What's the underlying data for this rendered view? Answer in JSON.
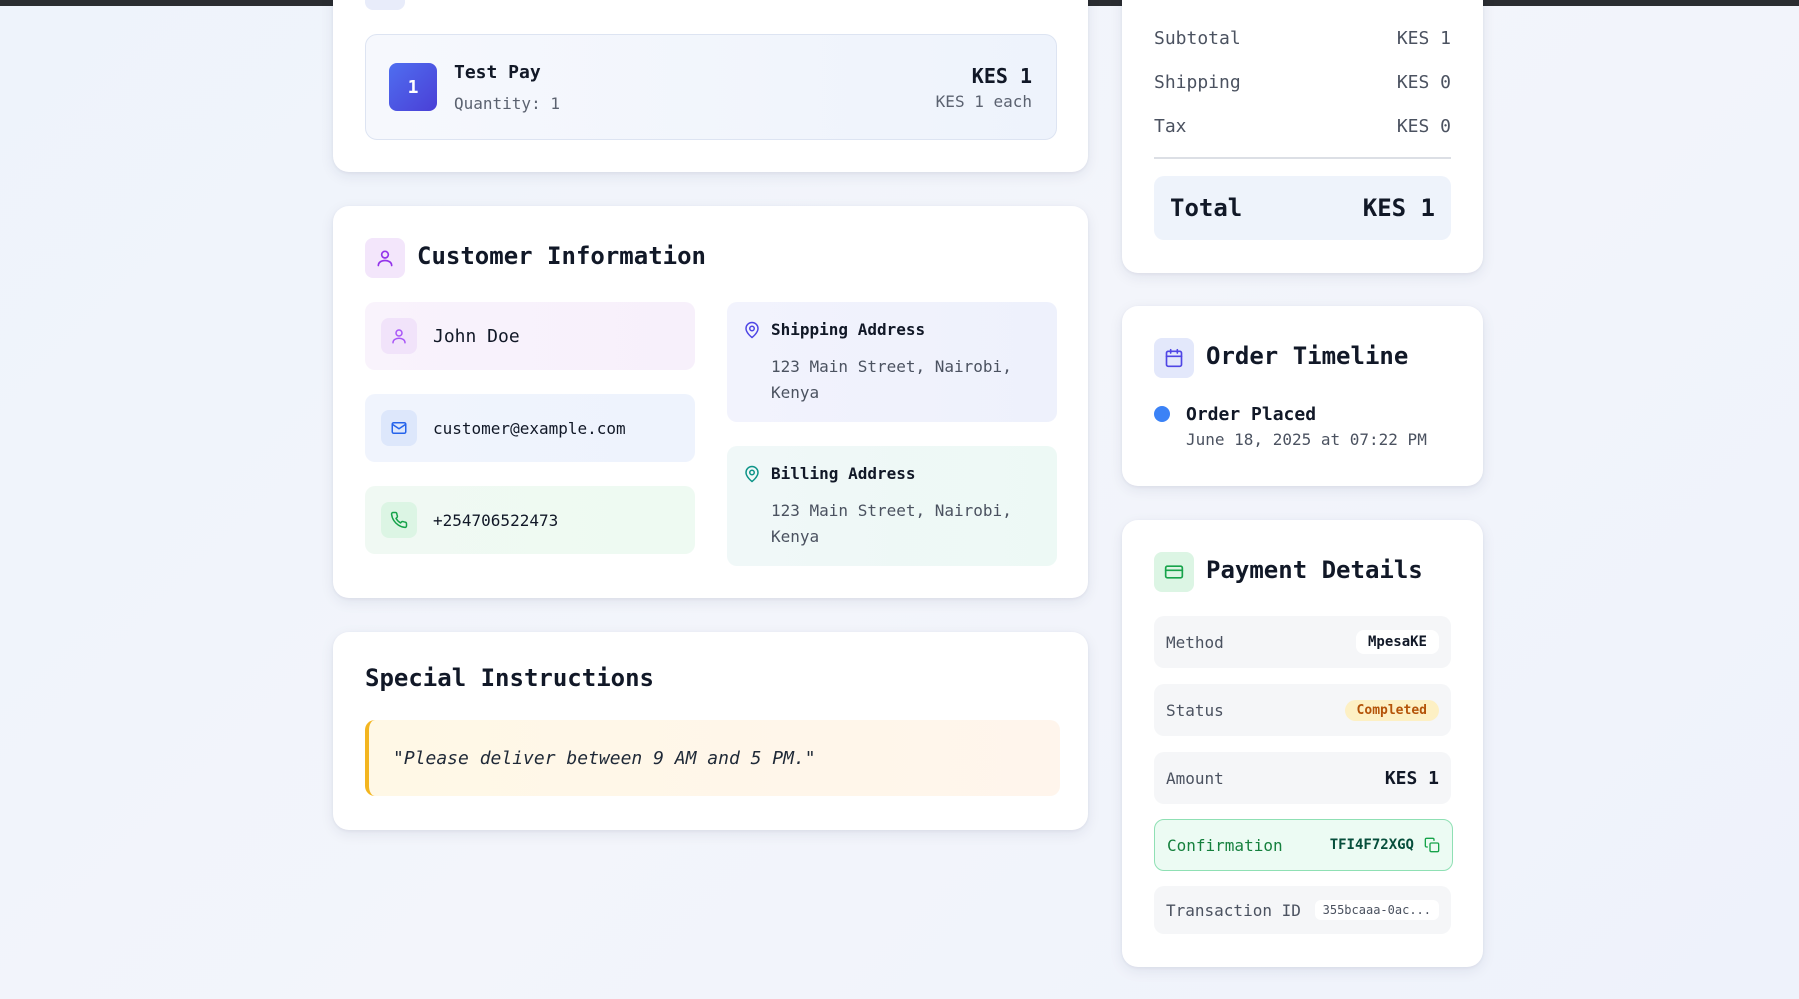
{
  "item": {
    "quantity_badge": "1",
    "name": "Test Pay",
    "quantity_label": "Quantity: 1",
    "price": "KES 1",
    "unit_price": "KES 1 each"
  },
  "customer": {
    "title": "Customer Information",
    "name": "John Doe",
    "email": "customer@example.com",
    "phone": "+254706522473",
    "shipping_title": "Shipping Address",
    "shipping_address": "123 Main Street, Nairobi, Kenya",
    "billing_title": "Billing Address",
    "billing_address": "123 Main Street, Nairobi, Kenya"
  },
  "instructions": {
    "title": "Special Instructions",
    "text": "\"Please deliver between 9 AM and 5 PM.\""
  },
  "summary": {
    "subtotal_label": "Subtotal",
    "subtotal_value": "KES 1",
    "shipping_label": "Shipping",
    "shipping_value": "KES 0",
    "tax_label": "Tax",
    "tax_value": "KES 0",
    "total_label": "Total",
    "total_value": "KES 1"
  },
  "timeline": {
    "title": "Order Timeline",
    "events": [
      {
        "label": "Order Placed",
        "date": "June 18, 2025 at 07:22 PM"
      }
    ]
  },
  "payment": {
    "title": "Payment Details",
    "method_label": "Method",
    "method_value": "MpesaKE",
    "status_label": "Status",
    "status_value": "Completed",
    "amount_label": "Amount",
    "amount_value": "KES 1",
    "confirmation_label": "Confirmation",
    "confirmation_value": "TFI4F72XGQ",
    "transaction_label": "Transaction ID",
    "transaction_value": "355bcaaa-0ac..."
  },
  "icons": {
    "customer": "user-icon",
    "name": "user-icon",
    "email": "mail-icon",
    "phone": "phone-icon",
    "address": "map-pin-icon",
    "timeline": "calendar-icon",
    "payment": "credit-card-icon",
    "copy": "copy-icon"
  },
  "colors": {
    "accent_indigo": "#4f46e5",
    "timeline_dot": "#3b82f6",
    "status_text": "#b45309",
    "confirmation_green": "#15803d",
    "instruction_border": "#f3b51f"
  }
}
